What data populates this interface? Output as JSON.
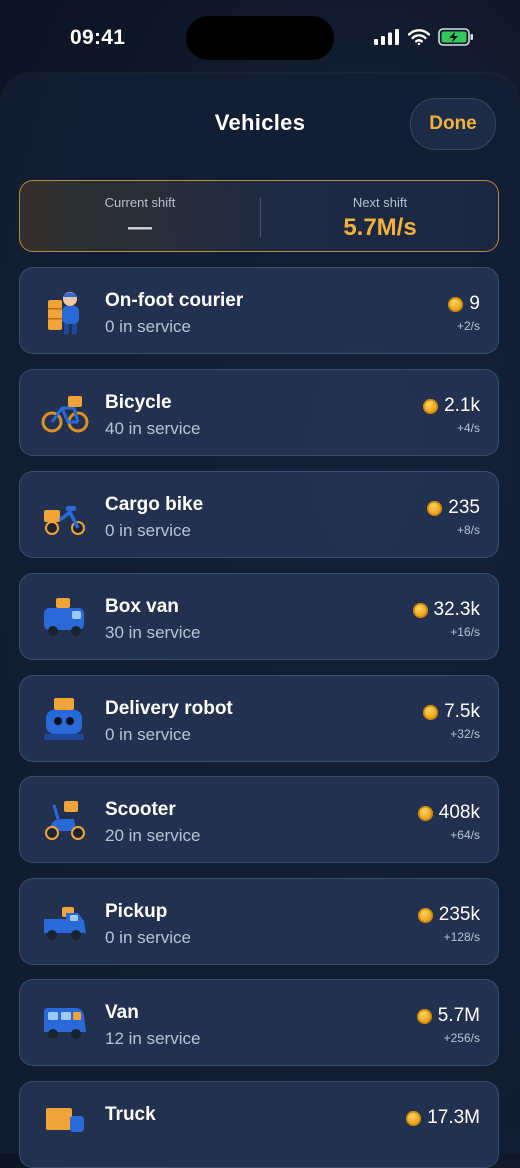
{
  "status_bar": {
    "time": "09:41"
  },
  "header": {
    "title": "Vehicles",
    "done_label": "Done"
  },
  "shift": {
    "current_label": "Current shift",
    "current_value": "—",
    "next_label": "Next shift",
    "next_value": "5.7M/s"
  },
  "colors": {
    "accent": "#f2b23a",
    "card_bg": "#24344f",
    "background": "#0f1829"
  },
  "vehicles": [
    {
      "name": "On-foot courier",
      "count": "0 in service",
      "price": "9",
      "rate": "+2/s",
      "icon": "courier-icon"
    },
    {
      "name": "Bicycle",
      "count": "40 in service",
      "price": "2.1k",
      "rate": "+4/s",
      "icon": "bicycle-icon"
    },
    {
      "name": "Cargo bike",
      "count": "0 in service",
      "price": "235",
      "rate": "+8/s",
      "icon": "cargo-bike-icon"
    },
    {
      "name": "Box van",
      "count": "30 in service",
      "price": "32.3k",
      "rate": "+16/s",
      "icon": "box-van-icon"
    },
    {
      "name": "Delivery robot",
      "count": "0 in service",
      "price": "7.5k",
      "rate": "+32/s",
      "icon": "robot-icon"
    },
    {
      "name": "Scooter",
      "count": "20 in service",
      "price": "408k",
      "rate": "+64/s",
      "icon": "scooter-icon"
    },
    {
      "name": "Pickup",
      "count": "0 in service",
      "price": "235k",
      "rate": "+128/s",
      "icon": "pickup-icon"
    },
    {
      "name": "Van",
      "count": "12 in service",
      "price": "5.7M",
      "rate": "+256/s",
      "icon": "van-icon"
    },
    {
      "name": "Truck",
      "count": "",
      "price": "17.3M",
      "rate": "",
      "icon": "truck-icon"
    }
  ]
}
